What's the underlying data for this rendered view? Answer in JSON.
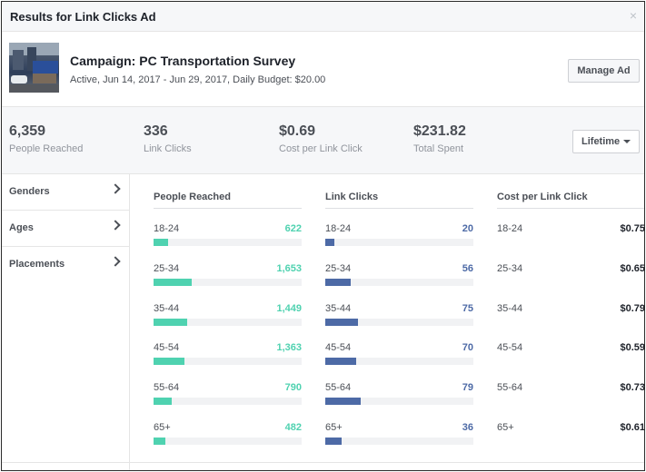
{
  "dialog": {
    "title": "Results for Link Clicks Ad",
    "close_glyph": "×"
  },
  "campaign": {
    "title": "Campaign: PC Transportation Survey",
    "subtitle": "Active, Jun 14, 2017 - Jun 29, 2017, Daily Budget: $20.00",
    "manage_label": "Manage Ad"
  },
  "stats": [
    {
      "value": "6,359",
      "label": "People Reached"
    },
    {
      "value": "336",
      "label": "Link Clicks"
    },
    {
      "value": "$0.69",
      "label": "Cost per Link Click"
    },
    {
      "value": "$231.82",
      "label": "Total Spent"
    }
  ],
  "time_range": {
    "label": "Lifetime"
  },
  "sidebar": {
    "items": [
      {
        "label": "Genders"
      },
      {
        "label": "Ages"
      },
      {
        "label": "Placements"
      }
    ]
  },
  "breakdown": {
    "columns": {
      "reached": {
        "header": "People Reached",
        "color": "#4fd2b0"
      },
      "clicks": {
        "header": "Link Clicks",
        "color": "#4d6aa6"
      },
      "cost": {
        "header": "Cost per Link Click"
      }
    },
    "rows": [
      {
        "age": "18-24",
        "reached": "622",
        "reached_frac": 0.1,
        "clicks": "20",
        "clicks_frac": 0.06,
        "cost": "$0.75"
      },
      {
        "age": "25-34",
        "reached": "1,653",
        "reached_frac": 0.26,
        "clicks": "56",
        "clicks_frac": 0.17,
        "cost": "$0.65"
      },
      {
        "age": "35-44",
        "reached": "1,449",
        "reached_frac": 0.23,
        "clicks": "75",
        "clicks_frac": 0.22,
        "cost": "$0.79"
      },
      {
        "age": "45-54",
        "reached": "1,363",
        "reached_frac": 0.21,
        "clicks": "70",
        "clicks_frac": 0.21,
        "cost": "$0.59"
      },
      {
        "age": "55-64",
        "reached": "790",
        "reached_frac": 0.12,
        "clicks": "79",
        "clicks_frac": 0.24,
        "cost": "$0.73"
      },
      {
        "age": "65+",
        "reached": "482",
        "reached_frac": 0.08,
        "clicks": "36",
        "clicks_frac": 0.11,
        "cost": "$0.61"
      }
    ]
  }
}
